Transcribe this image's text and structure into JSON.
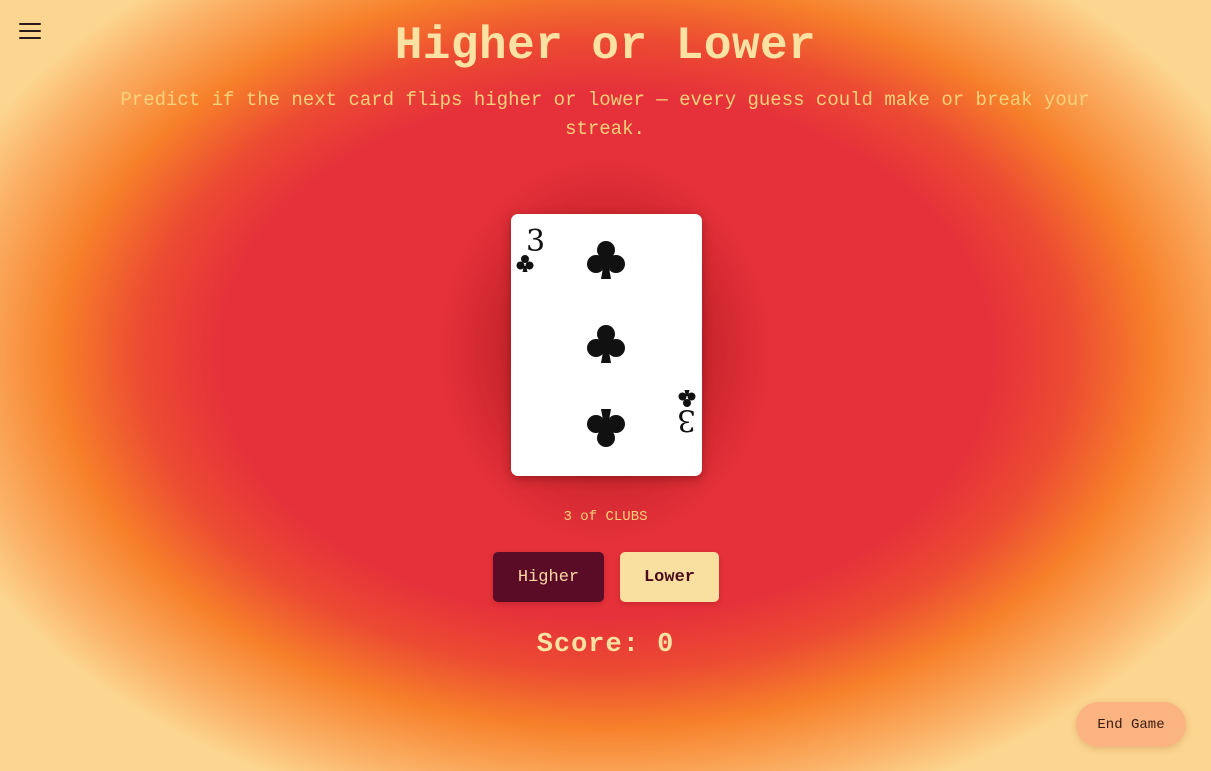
{
  "page": {
    "title": "Higher or Lower",
    "subtitle": "Predict if the next card flips higher or lower — every guess could make or break your streak."
  },
  "menu": {
    "icon": "hamburger-menu-icon"
  },
  "card": {
    "rank": "3",
    "suit": "clubs",
    "suit_symbol": "♣",
    "caption": "3 of CLUBS"
  },
  "actions": {
    "higher_label": "Higher",
    "lower_label": "Lower",
    "end_game_label": "End Game"
  },
  "score": {
    "label": "Score:",
    "value": 0
  },
  "colors": {
    "background_center": "#e6313a",
    "background_edge": "#fcd690",
    "title": "#fbe2a2",
    "subtitle": "#f8d27a",
    "higher_button": "#5a0c26",
    "lower_button": "#f9dfa0",
    "end_game_button": "#fbb481"
  }
}
